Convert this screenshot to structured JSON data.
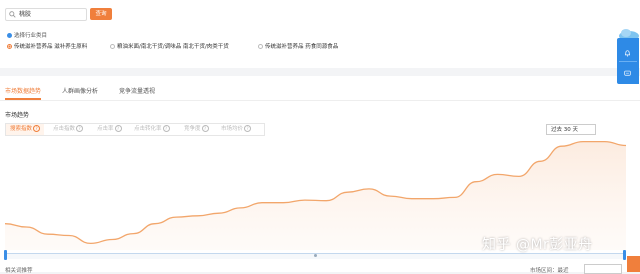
{
  "search": {
    "value": "桃胶",
    "button_label": "查询"
  },
  "industry": {
    "label": "选择行业类目",
    "options": [
      {
        "label": "传统滋补营养品 滋补养生原料",
        "selected": true
      },
      {
        "label": "粮油米面/南北干货/调味品 南北干货/肉类干货",
        "selected": false
      },
      {
        "label": "传统滋补营养品 药食同源食品",
        "selected": false
      }
    ]
  },
  "tabs": [
    {
      "label": "市场数据趋势",
      "active": true
    },
    {
      "label": "人群画像分析",
      "active": false
    },
    {
      "label": "竞争流量透视",
      "active": false
    }
  ],
  "section_title": "市场趋势",
  "metrics": [
    {
      "label": "搜索指数",
      "active": true
    },
    {
      "label": "点击指数",
      "active": false
    },
    {
      "label": "点击率",
      "active": false
    },
    {
      "label": "点击转化率",
      "active": false
    },
    {
      "label": "竞争度",
      "active": false
    },
    {
      "label": "市场均价",
      "active": false
    }
  ],
  "time_range": "过去 30 天",
  "bottom": {
    "left_label": "相关词推荐",
    "right_label": "市场区间：最近",
    "button_label": ""
  },
  "watermark": "知乎 @Mr彭亚舟",
  "colors": {
    "accent": "#f07f3c",
    "primary_blue": "#2e8ae6",
    "line": "#f2a66b"
  },
  "chart_data": {
    "type": "area",
    "title": "",
    "xlabel": "",
    "ylabel": "",
    "grid": false,
    "series": [
      {
        "values": [
          40,
          35,
          24,
          22,
          10,
          16,
          25,
          40,
          50,
          52,
          56,
          64,
          72,
          72,
          76,
          75,
          88,
          93,
          82,
          78,
          78,
          80,
          104,
          115,
          112,
          135,
          158,
          165,
          165,
          159
        ]
      }
    ],
    "ylim": [
      0,
      175
    ]
  }
}
